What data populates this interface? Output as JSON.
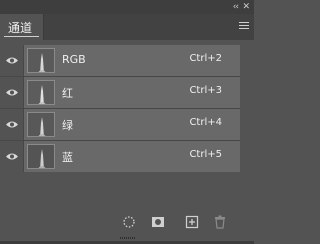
{
  "panel": {
    "tab_label": "通道",
    "collapse_glyph": "‹‹",
    "close_glyph": "✕"
  },
  "channels": [
    {
      "name": "RGB",
      "shortcut": "Ctrl+2"
    },
    {
      "name": "红",
      "shortcut": "Ctrl+3"
    },
    {
      "name": "绿",
      "shortcut": "Ctrl+4"
    },
    {
      "name": "蓝",
      "shortcut": "Ctrl+5"
    }
  ],
  "footer_icons": [
    "load-selection-icon",
    "save-mask-icon",
    "new-channel-icon",
    "delete-channel-icon"
  ],
  "colors": {
    "panel_bg": "#535353",
    "row_highlight": "#696969",
    "tab_bar": "#424242"
  }
}
